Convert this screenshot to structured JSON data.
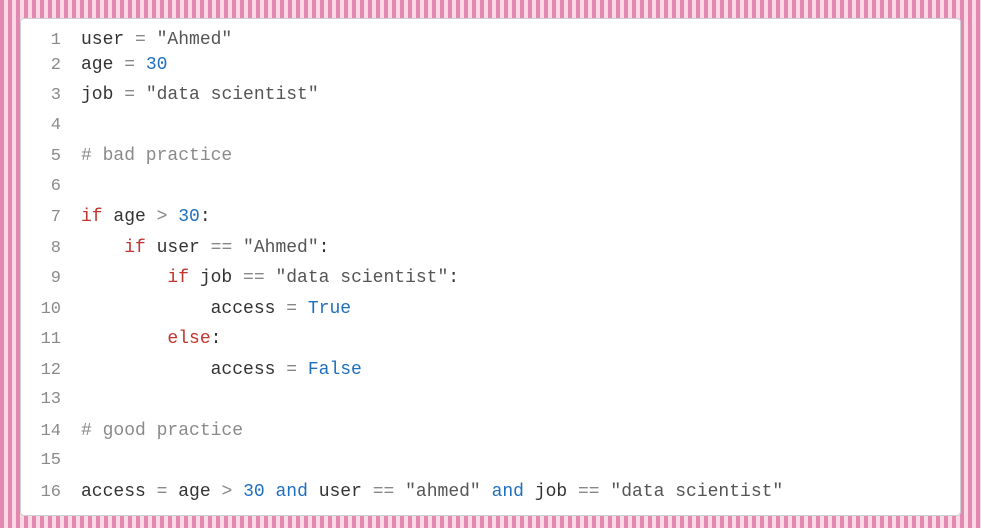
{
  "lines": [
    {
      "n": "1",
      "tokens": [
        {
          "t": "user ",
          "c": "tok-var"
        },
        {
          "t": "= ",
          "c": "tok-op"
        },
        {
          "t": "\"Ahmed\"",
          "c": "tok-str"
        }
      ]
    },
    {
      "n": "2",
      "tokens": [
        {
          "t": "age ",
          "c": "tok-var"
        },
        {
          "t": "= ",
          "c": "tok-op"
        },
        {
          "t": "30",
          "c": "tok-num"
        }
      ]
    },
    {
      "n": "3",
      "tokens": [
        {
          "t": "job ",
          "c": "tok-var"
        },
        {
          "t": "= ",
          "c": "tok-op"
        },
        {
          "t": "\"data scientist\"",
          "c": "tok-str"
        }
      ]
    },
    {
      "n": "4",
      "tokens": []
    },
    {
      "n": "5",
      "tokens": [
        {
          "t": "# bad practice",
          "c": "tok-cm"
        }
      ]
    },
    {
      "n": "6",
      "tokens": []
    },
    {
      "n": "7",
      "tokens": [
        {
          "t": "if ",
          "c": "tok-kw"
        },
        {
          "t": "age ",
          "c": "tok-var"
        },
        {
          "t": "> ",
          "c": "tok-op"
        },
        {
          "t": "30",
          "c": "tok-num"
        },
        {
          "t": ":",
          "c": "tok-punc"
        }
      ]
    },
    {
      "n": "8",
      "tokens": [
        {
          "t": "    ",
          "c": "tok-var"
        },
        {
          "t": "if ",
          "c": "tok-kw"
        },
        {
          "t": "user ",
          "c": "tok-var"
        },
        {
          "t": "== ",
          "c": "tok-op"
        },
        {
          "t": "\"Ahmed\"",
          "c": "tok-str"
        },
        {
          "t": ":",
          "c": "tok-punc"
        }
      ]
    },
    {
      "n": "9",
      "tokens": [
        {
          "t": "        ",
          "c": "tok-var"
        },
        {
          "t": "if ",
          "c": "tok-kw"
        },
        {
          "t": "job ",
          "c": "tok-var"
        },
        {
          "t": "== ",
          "c": "tok-op"
        },
        {
          "t": "\"data scientist\"",
          "c": "tok-str"
        },
        {
          "t": ":",
          "c": "tok-punc"
        }
      ]
    },
    {
      "n": "10",
      "tokens": [
        {
          "t": "            access ",
          "c": "tok-var"
        },
        {
          "t": "= ",
          "c": "tok-op"
        },
        {
          "t": "True",
          "c": "tok-bool"
        }
      ]
    },
    {
      "n": "11",
      "tokens": [
        {
          "t": "        ",
          "c": "tok-var"
        },
        {
          "t": "else",
          "c": "tok-kw"
        },
        {
          "t": ":",
          "c": "tok-punc"
        }
      ]
    },
    {
      "n": "12",
      "tokens": [
        {
          "t": "            access ",
          "c": "tok-var"
        },
        {
          "t": "= ",
          "c": "tok-op"
        },
        {
          "t": "False",
          "c": "tok-bool"
        }
      ]
    },
    {
      "n": "13",
      "tokens": []
    },
    {
      "n": "14",
      "tokens": [
        {
          "t": "# good practice",
          "c": "tok-cm"
        }
      ]
    },
    {
      "n": "15",
      "tokens": []
    },
    {
      "n": "16",
      "tokens": [
        {
          "t": "access ",
          "c": "tok-var"
        },
        {
          "t": "= ",
          "c": "tok-op"
        },
        {
          "t": "age ",
          "c": "tok-var"
        },
        {
          "t": "> ",
          "c": "tok-op"
        },
        {
          "t": "30",
          "c": "tok-num"
        },
        {
          "t": " ",
          "c": "tok-var"
        },
        {
          "t": "and ",
          "c": "tok-kw2"
        },
        {
          "t": "user ",
          "c": "tok-var"
        },
        {
          "t": "== ",
          "c": "tok-op"
        },
        {
          "t": "\"ahmed\"",
          "c": "tok-str"
        },
        {
          "t": " ",
          "c": "tok-var"
        },
        {
          "t": "and ",
          "c": "tok-kw2"
        },
        {
          "t": "job ",
          "c": "tok-var"
        },
        {
          "t": "== ",
          "c": "tok-op"
        },
        {
          "t": "\"data scientist\"",
          "c": "tok-str"
        }
      ]
    }
  ]
}
